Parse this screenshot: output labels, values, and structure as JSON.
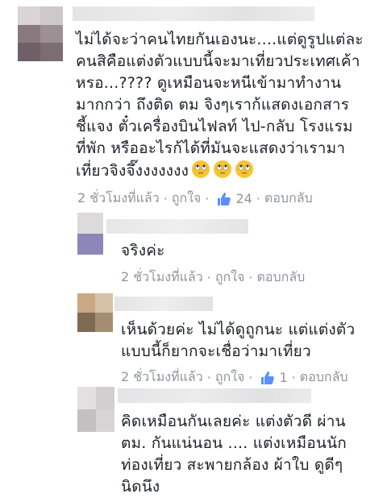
{
  "comments": [
    {
      "lines": [
        "ไม่ได้จะว่าคนไทยกันเองนะ....แต่ดูรูปแต่ละ",
        "คนสิคือแต่งตัวแบบนี้จะมาเที่ยวประเทศเค้า",
        "หรอ...???? ดูเหมือนจะหนีเข้ามาทำงาน",
        "มากกว่า ถึงติด ตม จิงๆเราก้แสดงเอกสาร",
        "ชี้แจง ตั๋วเครื่องบินไฟลท์ ไป-กลับ โรงแรม",
        "ที่พัก หรืออะไรก้ได้ที่มันจะแสดงว่าเรามา",
        "เที่ยวจิงจึ๊งงงงงงง"
      ],
      "emoji": [
        "face-with-rolling-eyes-icon",
        "face-with-rolling-eyes-icon",
        "face-with-rolling-eyes-icon"
      ],
      "time": "2 ชั่วโมงที่แล้ว",
      "like": "ถูกใจ",
      "like_count": "24",
      "reply": "ตอบกลับ"
    },
    {
      "lines": [
        "จริงค่ะ"
      ],
      "time": "2 ชั่วโมงที่แล้ว",
      "like": "ถูกใจ",
      "reply": "ตอบกลับ"
    },
    {
      "lines": [
        "เห็นด้วยค่ะ ไม่ได้ดูถูกนะ แต่แต่งตัว",
        "แบบนี้ก็ยากจะเชื่อว่ามาเที่ยว"
      ],
      "time": "2 ชั่วโมงที่แล้ว",
      "like": "ถูกใจ",
      "like_count": "1",
      "reply": "ตอบกลับ"
    },
    {
      "lines": [
        "คิดเหมือนกันเลยค่ะ  แต่งตัวดี  ผ่าน",
        "ตม. กันแน่นอน   .... แต่งเหมือนนัก",
        "ท่องเที่ยว  สะพายกล้อง  ผ้าใบ  ดูดีๆ",
        "นิดนึง"
      ]
    }
  ],
  "colors": {
    "text": "#1d2129",
    "meta": "#90949c",
    "like_blue": "#5890ff",
    "emoji_yellow": "#f7c533"
  },
  "separator": "·"
}
